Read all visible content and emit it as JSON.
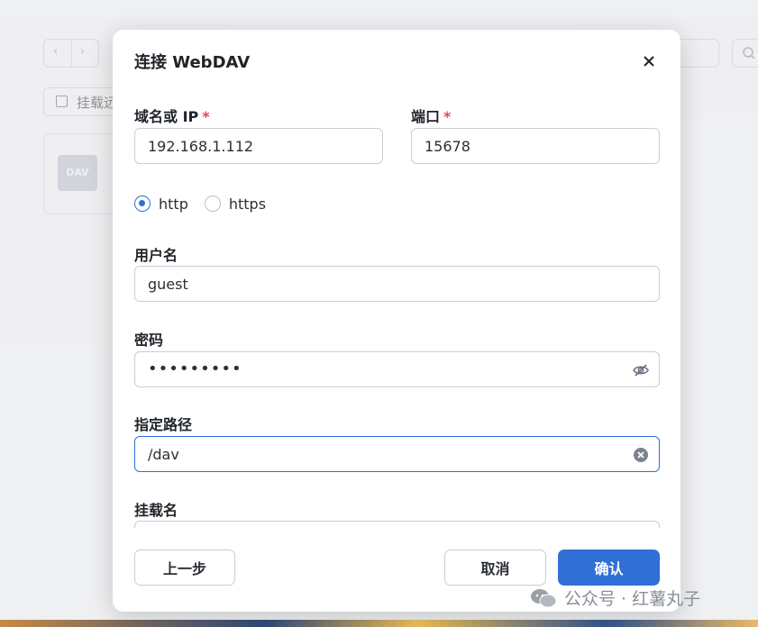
{
  "dialog": {
    "title": "连接 WebDAV",
    "host": {
      "label": "域名或 IP",
      "required_mark": "*",
      "value": "192.168.1.112"
    },
    "port": {
      "label": "端口",
      "required_mark": "*",
      "value": "15678"
    },
    "protocol": {
      "options": [
        "http",
        "https"
      ],
      "selected": "http"
    },
    "username": {
      "label": "用户名",
      "value": "guest"
    },
    "password": {
      "label": "密码",
      "value": "•••••••••"
    },
    "path": {
      "label": "指定路径",
      "value": "/dav"
    },
    "mount_name": {
      "label": "挂载名",
      "value": ""
    },
    "buttons": {
      "prev": "上一步",
      "cancel": "取消",
      "confirm": "确认"
    }
  },
  "background": {
    "mount_button_label": "挂载远",
    "card_icon_text": "DAV"
  },
  "watermark": {
    "text": "公众号 · 红薯丸子"
  },
  "colors": {
    "accent": "#2f6fd6",
    "required": "#e5484d"
  }
}
